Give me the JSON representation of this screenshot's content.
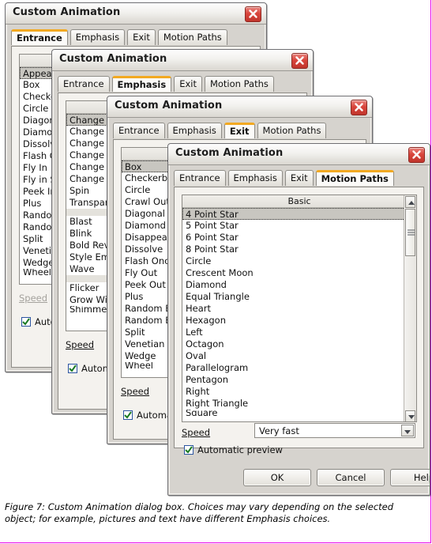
{
  "figure": {
    "caption": "Figure 7: Custom Animation dialog box. Choices may vary depending on the selected object; for example, pictures and text have different Emphasis choices.",
    "border_color": "#e800e8",
    "accent_color": "#f2a922",
    "close_button_color": "#d9453c"
  },
  "windows": [
    {
      "title": "Custom Animation",
      "close_icon": "close-icon",
      "tabs": [
        {
          "label": "Entrance",
          "active": true
        },
        {
          "label": "Emphasis",
          "active": false
        },
        {
          "label": "Exit",
          "active": false
        },
        {
          "label": "Motion Paths",
          "active": false
        }
      ],
      "list": {
        "header": "",
        "items": [
          {
            "label": "Appear",
            "selected": true
          },
          {
            "label": "Box"
          },
          {
            "label": "Checkerboard"
          },
          {
            "label": "Circle"
          },
          {
            "label": "Diagonal Squares"
          },
          {
            "label": "Diamond"
          },
          {
            "label": "Dissolve In"
          },
          {
            "label": "Flash Once"
          },
          {
            "label": "Fly In"
          },
          {
            "label": "Fly in Slow"
          },
          {
            "label": "Peek In"
          },
          {
            "label": "Plus"
          },
          {
            "label": "Random Bars"
          },
          {
            "label": "Random Effects"
          },
          {
            "label": "Split"
          },
          {
            "label": "Venetian Blinds"
          },
          {
            "label": "Wedge"
          },
          {
            "label": "Wheel"
          }
        ]
      },
      "speed_label": "Speed",
      "automatic_preview_label": "Automatic preview",
      "automatic_preview_checked": true
    },
    {
      "title": "Custom Animation",
      "close_icon": "close-icon",
      "tabs": [
        {
          "label": "Entrance",
          "active": false
        },
        {
          "label": "Emphasis",
          "active": true
        },
        {
          "label": "Exit",
          "active": false
        },
        {
          "label": "Motion Paths",
          "active": false
        }
      ],
      "list": {
        "header": "",
        "items": [
          {
            "label": "Change Fill Color",
            "selected": true
          },
          {
            "label": "Change Font"
          },
          {
            "label": "Change Font Color"
          },
          {
            "label": "Change Font Size"
          },
          {
            "label": "Change Font Style"
          },
          {
            "label": "Change Line Color"
          },
          {
            "label": "Spin"
          },
          {
            "label": "Transparency"
          },
          {
            "label": "",
            "separator": true
          },
          {
            "label": "Blast"
          },
          {
            "label": "Blink"
          },
          {
            "label": "Bold Reveal"
          },
          {
            "label": "Style Emphasis"
          },
          {
            "label": "Wave"
          },
          {
            "label": "",
            "separator": true
          },
          {
            "label": "Flicker"
          },
          {
            "label": "Grow With Color"
          },
          {
            "label": "Shimmer"
          }
        ]
      },
      "speed_label": "Speed",
      "automatic_preview_label": "Automatic preview",
      "automatic_preview_checked": true
    },
    {
      "title": "Custom Animation",
      "close_icon": "close-icon",
      "tabs": [
        {
          "label": "Entrance",
          "active": false
        },
        {
          "label": "Emphasis",
          "active": false
        },
        {
          "label": "Exit",
          "active": true
        },
        {
          "label": "Motion Paths",
          "active": false
        }
      ],
      "list": {
        "header": "",
        "items": [
          {
            "label": "Box",
            "selected": true
          },
          {
            "label": "Checkerboard"
          },
          {
            "label": "Circle"
          },
          {
            "label": "Crawl Out"
          },
          {
            "label": "Diagonal Squares"
          },
          {
            "label": "Diamond"
          },
          {
            "label": "Disappear"
          },
          {
            "label": "Dissolve"
          },
          {
            "label": "Flash Once"
          },
          {
            "label": "Fly Out"
          },
          {
            "label": "Peek Out"
          },
          {
            "label": "Plus"
          },
          {
            "label": "Random Bars"
          },
          {
            "label": "Random Effects"
          },
          {
            "label": "Split"
          },
          {
            "label": "Venetian Blinds"
          },
          {
            "label": "Wedge"
          },
          {
            "label": "Wheel"
          }
        ]
      },
      "speed_label": "Speed",
      "automatic_preview_label": "Automatic preview",
      "automatic_preview_checked": true
    },
    {
      "title": "Custom Animation",
      "close_icon": "close-icon",
      "tabs": [
        {
          "label": "Entrance",
          "active": false
        },
        {
          "label": "Emphasis",
          "active": false
        },
        {
          "label": "Exit",
          "active": false
        },
        {
          "label": "Motion Paths",
          "active": true
        }
      ],
      "list": {
        "header": "Basic",
        "items": [
          {
            "label": "4 Point Star",
            "selected": true
          },
          {
            "label": "5 Point Star"
          },
          {
            "label": "6 Point Star"
          },
          {
            "label": "8 Point Star"
          },
          {
            "label": "Circle"
          },
          {
            "label": "Crescent Moon"
          },
          {
            "label": "Diamond"
          },
          {
            "label": "Equal Triangle"
          },
          {
            "label": "Heart"
          },
          {
            "label": "Hexagon"
          },
          {
            "label": "Left"
          },
          {
            "label": "Octagon"
          },
          {
            "label": "Oval"
          },
          {
            "label": "Parallelogram"
          },
          {
            "label": "Pentagon"
          },
          {
            "label": "Right"
          },
          {
            "label": "Right Triangle"
          },
          {
            "label": "Square"
          }
        ]
      },
      "speed_label": "Speed",
      "speed_value": "Very fast",
      "automatic_preview_label": "Automatic preview",
      "automatic_preview_checked": true,
      "buttons": {
        "ok": "OK",
        "cancel": "Cancel",
        "help": "Help"
      }
    }
  ]
}
